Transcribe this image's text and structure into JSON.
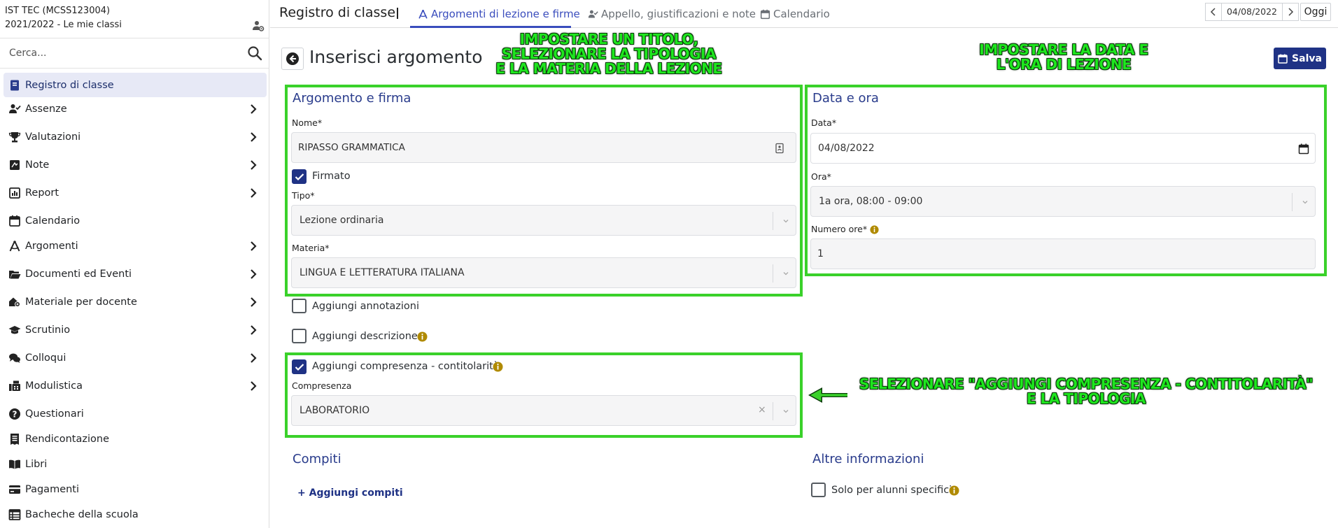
{
  "sidebar": {
    "school_name": "IST TEC (MCSS123004)",
    "school_year": "2021/2022 - Le mie classi",
    "search_placeholder": "Cerca...",
    "items": [
      {
        "label": "Registro di classe",
        "icon": "register-book-icon",
        "active": true,
        "has_submenu": false
      },
      {
        "label": "Assenze",
        "icon": "user-check-icon",
        "active": false,
        "has_submenu": true
      },
      {
        "label": "Valutazioni",
        "icon": "trophy-icon",
        "active": false,
        "has_submenu": true
      },
      {
        "label": "Note",
        "icon": "note-icon",
        "active": false,
        "has_submenu": true
      },
      {
        "label": "Report",
        "icon": "report-chart-icon",
        "active": false,
        "has_submenu": true
      },
      {
        "label": "Calendario",
        "icon": "calendar-icon",
        "active": false,
        "has_submenu": false
      },
      {
        "label": "Argomenti",
        "icon": "compass-icon",
        "active": false,
        "has_submenu": true
      },
      {
        "label": "Documenti ed Eventi",
        "icon": "folder-open-icon",
        "active": false,
        "has_submenu": true
      },
      {
        "label": "Materiale per docente",
        "icon": "house-share-icon",
        "active": false,
        "has_submenu": true
      },
      {
        "label": "Scrutinio",
        "icon": "graduation-cap-icon",
        "active": false,
        "has_submenu": true
      },
      {
        "label": "Colloqui",
        "icon": "comments-icon",
        "active": false,
        "has_submenu": true
      },
      {
        "label": "Modulistica",
        "icon": "fax-icon",
        "active": false,
        "has_submenu": true
      },
      {
        "label": "Questionari",
        "icon": "question-circle-icon",
        "active": false,
        "has_submenu": false
      },
      {
        "label": "Rendicontazione",
        "icon": "receipt-icon",
        "active": false,
        "has_submenu": false
      },
      {
        "label": "Libri",
        "icon": "book-open-icon",
        "active": false,
        "has_submenu": false
      },
      {
        "label": "Pagamenti",
        "icon": "credit-card-icon",
        "active": false,
        "has_submenu": false
      },
      {
        "label": "Bacheche della scuola",
        "icon": "table-board-icon",
        "active": false,
        "has_submenu": false
      }
    ]
  },
  "header": {
    "title": "Registro di classe",
    "tabs": [
      {
        "label": "Argomenti di lezione e firme",
        "icon": "compass-icon",
        "active": true
      },
      {
        "label": "Appello, giustificazioni e note",
        "icon": "user-check-icon",
        "active": false
      },
      {
        "label": "Calendario",
        "icon": "calendar-icon",
        "active": false
      }
    ],
    "date": "04/08/2022",
    "today_label": "Oggi"
  },
  "page": {
    "title": "Inserisci argomento",
    "save_label": "Salva"
  },
  "argomento": {
    "section_title": "Argomento e firma",
    "nome_label": "Nome*",
    "nome_value": "RIPASSO GRAMMATICA",
    "firmato_label": "Firmato",
    "firmato_checked": true,
    "tipo_label": "Tipo*",
    "tipo_value": "Lezione ordinaria",
    "materia_label": "Materia*",
    "materia_value": "LINGUA E LETTERATURA ITALIANA",
    "annotazioni_label": "Aggiungi annotazioni",
    "annotazioni_checked": false,
    "descrizione_label": "Aggiungi descrizione",
    "descrizione_checked": false,
    "compresenza_check_label": "Aggiungi compresenza - contitolarità",
    "compresenza_checked": true,
    "compresenza_label": "Compresenza",
    "compresenza_value": "LABORATORIO",
    "clear_symbol": "×"
  },
  "data_ora": {
    "section_title": "Data e ora",
    "data_label": "Data*",
    "data_value": "04/08/2022",
    "ora_label": "Ora*",
    "ora_value": "1a ora, 08:00 - 09:00",
    "numero_ore_label": "Numero ore*",
    "numero_ore_value": "1"
  },
  "compiti": {
    "section_title": "Compiti",
    "add_label": "+ Aggiungi compiti"
  },
  "altre": {
    "section_title": "Altre informazioni",
    "solo_label": "Solo per alunni specifici",
    "solo_checked": false
  },
  "annotations": {
    "top_left": [
      "IMPOSTARE UN TITOLO,",
      "SELEZIONARE LA TIPOLOGIA",
      "E LA MATERIA DELLA LEZIONE"
    ],
    "top_right": [
      "IMPOSTARE LA DATA E",
      "L'ORA DI LEZIONE"
    ],
    "bottom_right": [
      "SELEZIONARE \"AGGIUNGI COMPRESENZA - CONTITOLARITÀ\"",
      "E LA TIPOLOGIA"
    ]
  },
  "colors": {
    "accent": "#1f3285",
    "tab_active": "#3a4dbd",
    "annotation": "#3ad12a",
    "info": "#b08a00"
  }
}
